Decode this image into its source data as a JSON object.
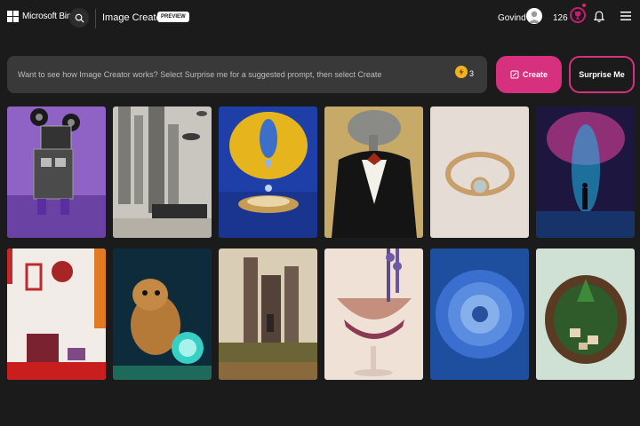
{
  "header": {
    "brand": "Microsoft Bing",
    "product": "Image Creator",
    "badge": "PREVIEW",
    "user_name": "Govind",
    "reward_points": "126"
  },
  "prompt": {
    "placeholder": "Want to see how Image Creator works? Select Surprise me for a suggested prompt, then select Create",
    "boosts": "3"
  },
  "actions": {
    "create_label": "Create",
    "surprise_label": "Surprise Me"
  },
  "icons": {
    "search": "search-icon",
    "rewards": "rewards-icon",
    "bell": "bell-icon",
    "menu": "hamburger-menu-icon",
    "boost": "boost-coin-icon"
  },
  "colors": {
    "background": "#1c1b1b",
    "accent": "#d6307e",
    "prompt_bg": "#3a3939",
    "boost": "#f0b31f"
  },
  "gallery": [
    {
      "subject": "robot-with-reels"
    },
    {
      "subject": "ruined-city-with-ufos"
    },
    {
      "subject": "melting-lemon-drop"
    },
    {
      "subject": "elephant-in-tuxedo"
    },
    {
      "subject": "gold-ring"
    },
    {
      "subject": "figure-in-nebula"
    },
    {
      "subject": "red-white-room"
    },
    {
      "subject": "hamster-with-crystal-ball"
    },
    {
      "subject": "castle-ruins-painting"
    },
    {
      "subject": "lavender-cocktail"
    },
    {
      "subject": "blue-dahlia"
    },
    {
      "subject": "terrarium-village"
    }
  ]
}
